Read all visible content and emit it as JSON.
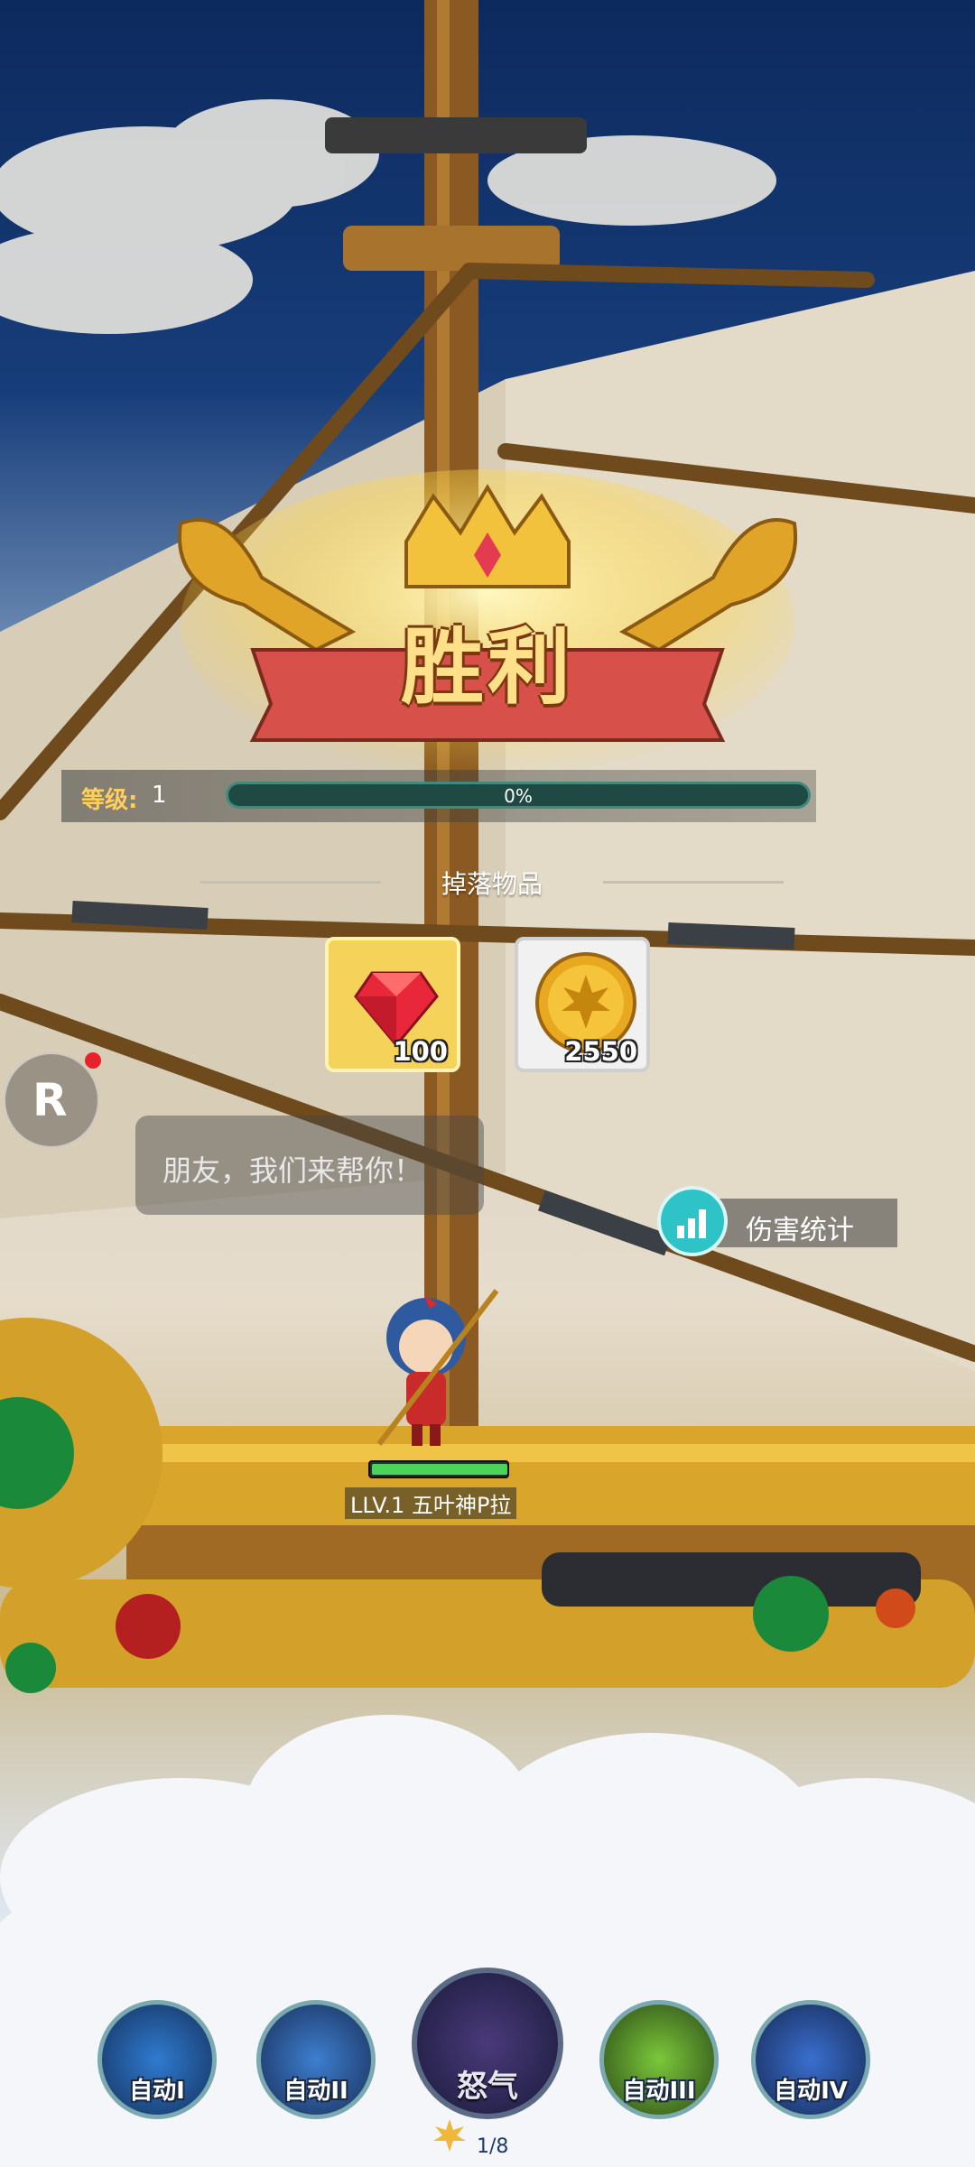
{
  "victory": {
    "title": "胜利"
  },
  "level": {
    "label": "等级:",
    "value": "1",
    "progress_text": "0%",
    "progress": 0
  },
  "drops": {
    "title": "掉落物品",
    "items": [
      {
        "icon": "ruby-gem-icon",
        "count": "100"
      },
      {
        "icon": "gold-maple-coin-icon",
        "count": "2550"
      }
    ]
  },
  "r_button": {
    "letter": "R"
  },
  "chat": {
    "text": "朋友，我们来帮你！"
  },
  "damage_stats": {
    "label": "伤害统计"
  },
  "player": {
    "name": "LLV.1 五叶神P拉",
    "hp": 1
  },
  "skills": [
    {
      "label": "自动I"
    },
    {
      "label": "自动II"
    },
    {
      "label": "怒气"
    },
    {
      "label": "自动III"
    },
    {
      "label": "自动IV"
    }
  ],
  "rage_counter": "1/8",
  "colors": {
    "accent_gold": "#ffcf5a",
    "progress_teal": "#3f8a7d",
    "item_rare_bg": "#f5d25a"
  }
}
